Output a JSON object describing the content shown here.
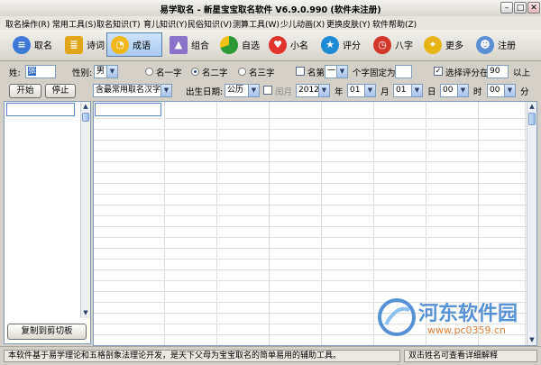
{
  "window": {
    "title": "易学取名 - 新星宝宝取名软件 V6.9.0.990 (软件未注册)"
  },
  "menu": [
    "取名操作(R)",
    "常用工具(S)",
    "取名知识(T)",
    "育儿知识(Y)",
    "民俗知识(V)",
    "测算工具(W)",
    "少儿动画(X)",
    "更换皮肤(Y)",
    "软件帮助(Z)"
  ],
  "toolbar": [
    {
      "label": "取名",
      "icon": "user-card-icon"
    },
    {
      "label": "诗词",
      "icon": "book-icon"
    },
    {
      "label": "成语",
      "icon": "bell-icon"
    },
    {
      "label": "组合",
      "icon": "star-icon"
    },
    {
      "label": "自选",
      "icon": "pie-chart-icon"
    },
    {
      "label": "小名",
      "icon": "heart-icon"
    },
    {
      "label": "评分",
      "icon": "rating-icon"
    },
    {
      "label": "八字",
      "icon": "clock-icon"
    },
    {
      "label": "更多",
      "icon": "stars-icon"
    },
    {
      "label": "注册",
      "icon": "user-group-icon"
    }
  ],
  "form": {
    "surname_label": "姓:",
    "surname_value": "张",
    "gender_label": "性别:",
    "gender_value": "男",
    "radio1": "名一字",
    "radio2": "名二字",
    "radio3": "名三字",
    "nth_label": "名第",
    "nth_value": "一",
    "fixed_label": "个字固定为",
    "score_label": "选择评分在",
    "score_value": "90",
    "score_suffix": "以上",
    "start_button": "开始",
    "stop_button": "停止",
    "library_value": "含最常用取名汉字",
    "birth_label": "出生日期:",
    "calendar_value": "公历",
    "leap_label": "闰月",
    "year_value": "2012",
    "year_unit": "年",
    "month_value": "01",
    "month_unit": "月",
    "day_value": "01",
    "day_unit": "日",
    "hour_value": "00",
    "hour_unit": "时",
    "minute_value": "00",
    "minute_unit": "分"
  },
  "left_panel": {
    "copy_button": "复制到剪切板"
  },
  "status": {
    "left": "本软件基于易学理论和五格剖象法理论开发，是天下父母为宝宝取名的简单易用的辅助工具。",
    "right": "双击姓名可查看详细解释"
  },
  "watermark": {
    "name": "河东软件园",
    "url": "www.pc0359.cn"
  }
}
